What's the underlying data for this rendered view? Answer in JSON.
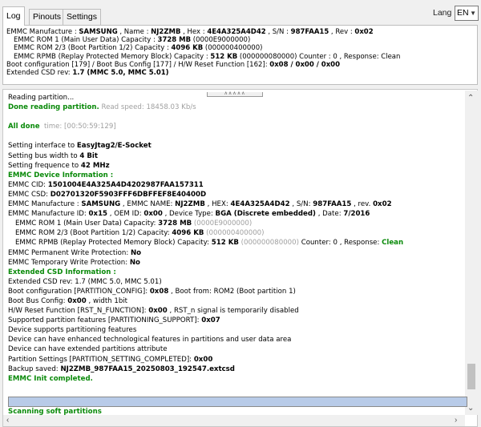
{
  "tabs": [
    "Log",
    "Pinouts",
    "Settings"
  ],
  "lang": {
    "label": "Lang",
    "value": "EN"
  },
  "info": {
    "l1": {
      "a": "EMMC Manufacture : ",
      "b": "SAMSUNG",
      "c": " , Name : ",
      "d": "NJ2ZMB",
      "e": " , Hex : ",
      "f": "4E4A325A4D42",
      "g": " , S/N : ",
      "h": "987FAA15",
      "i": " , Rev : ",
      "j": "0x02"
    },
    "l2": {
      "a": "EMMC ROM 1 (Main User Data) Capacity : ",
      "b": "3728 MB",
      "c": " (0000E9000000)"
    },
    "l3": {
      "a": "EMMC ROM 2/3 (Boot Partition 1/2) Capacity : ",
      "b": "4096 KB",
      "c": " (000000400000)"
    },
    "l4": {
      "a": "EMMC RPMB (Replay Protected Memory Block) Capacity : ",
      "b": "512 KB",
      "c": " (000000080000) Counter : 0 , Response: Clean"
    },
    "l5": {
      "a": "Boot configuration [179] / Boot Bus Config [177] / H/W Reset Function [162]: ",
      "b": "0x08 / 0x00 / 0x00"
    },
    "l6": {
      "a": "Extended CSD rev: ",
      "b": "1.7 (MMC 5.0, MMC 5.01)"
    }
  },
  "log": {
    "reading": "Reading partition...",
    "done_reading": "Done reading partition.",
    "read_speed": "Read speed: 18458.03 Kb/s",
    "all_done": "All done",
    "time": "time: [00:50:59:129]",
    "iface_a": "Setting interface to ",
    "iface_b": "EasyJtag2/E-Socket",
    "bus_a": "Setting bus width to ",
    "bus_b": "4 Bit",
    "freq_a": "Setting frequence to ",
    "freq_b": "42 MHz",
    "emmc_info": "EMMC Device Information :",
    "cid_a": "EMMC CID: ",
    "cid_b": "1501004E4A325A4D4202987FAA157311",
    "csd_a": "EMMC CSD: ",
    "csd_b": "D02701320F5903FFF6DBFFEF8E40400D",
    "man_a": "EMMC Manufacture : ",
    "man_b": "SAMSUNG",
    "man_c": " , EMMC NAME: ",
    "man_d": "NJ2ZMB",
    "man_e": " , HEX: ",
    "man_f": "4E4A325A4D42",
    "man_g": " , S/N: ",
    "man_h": "987FAA15",
    "man_i": " , rev. ",
    "man_j": "0x02",
    "mid_a": "EMMC Manufacture ID: ",
    "mid_b": "0x15",
    "mid_c": " , OEM ID: ",
    "mid_d": "0x00",
    "mid_e": " , Device Type: ",
    "mid_f": "BGA (Discrete embedded)",
    "mid_g": " , Date: ",
    "mid_h": "7/2016",
    "rom1_a": "EMMC ROM 1 (Main User Data) Capacity: ",
    "rom1_b": "3728 MB",
    "rom1_c": " (0000E9000000)",
    "rom2_a": "EMMC ROM 2/3 (Boot Partition 1/2) Capacity: ",
    "rom2_b": "4096 KB",
    "rom2_c": " (000000400000)",
    "rpmb_a": "EMMC RPMB (Replay Protected Memory Block) Capacity: ",
    "rpmb_b": "512 KB",
    "rpmb_c": " (000000080000)",
    "rpmb_d": " Counter: 0 , Response: ",
    "rpmb_e": "Clean",
    "perm_a": "EMMC Permanent Write Protection: ",
    "perm_b": "No",
    "temp_a": "EMMC Temporary Write Protection: ",
    "temp_b": "No",
    "ext_info": "Extended CSD Information :",
    "ext_rev": "Extended CSD rev: 1.7 (MMC 5.0, MMC 5.01)",
    "bootcfg_a": "Boot configuration [PARTITION_CONFIG]: ",
    "bootcfg_b": "0x08",
    "bootcfg_c": " , Boot from: ROM2 (Boot partition 1)",
    "bootbus_a": "Boot Bus Config: ",
    "bootbus_b": "0x00",
    "bootbus_c": " , width 1bit",
    "hwreset_a": "H/W Reset Function [RST_N_FUNCTION]: ",
    "hwreset_b": "0x00",
    "hwreset_c": " , RST_n signal is temporarily disabled",
    "supp_a": "Supported partition features [PARTITIONING_SUPPORT]: ",
    "supp_b": "0x07",
    "dev1": "Device supports partitioning features",
    "dev2": "Device can have enhanced technological features in partitions and user data area",
    "dev3": "Device can have extended partitions attribute",
    "pset_a": "Partition Settings [PARTITION_SETTING_COMPLETED]: ",
    "pset_b": "0x00",
    "backup_a": "Backup saved: ",
    "backup_b": "NJ2ZMB_987FAA15_20250803_192547.extcsd",
    "init_done": "EMMC Init completed.",
    "scanning": "Scanning soft partitions"
  },
  "progress": {
    "value_pct": 100
  },
  "icons": {
    "scroll_up": "chevron-up-icon",
    "scroll_down": "chevron-down-icon",
    "scroll_left": "chevron-left-icon",
    "scroll_right": "chevron-right-icon",
    "dropdown": "dropdown-arrow-icon"
  },
  "colors": {
    "green": "#0a8a0a",
    "progress": "#b8cbe8"
  }
}
